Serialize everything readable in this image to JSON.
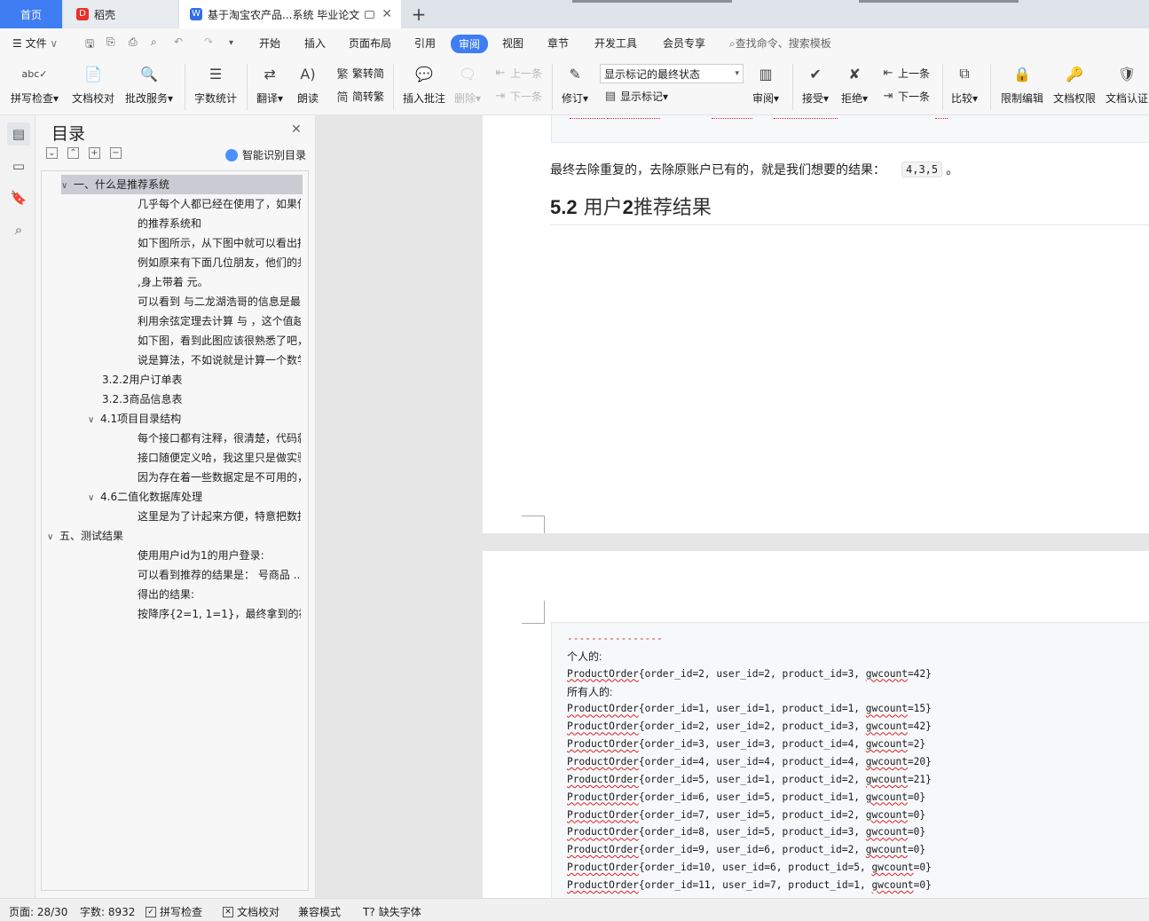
{
  "tabs": {
    "home": "首页",
    "daoke": "稻壳",
    "doc": "基于淘宝农产品...系统 毕业论文",
    "add": "+"
  },
  "menu": {
    "file": "文件",
    "items": [
      "开始",
      "插入",
      "页面布局",
      "引用",
      "审阅",
      "视图",
      "章节",
      "开发工具",
      "会员专享"
    ],
    "search": "查找命令、搜索模板"
  },
  "ribbon": {
    "spell": "拼写检查",
    "proof": "文档校对",
    "revise_service": "批改服务",
    "word_count": "字数统计",
    "translate": "翻译",
    "read_aloud": "朗读",
    "trad_to_simp": "繁转简",
    "simp_to_trad": "简转繁",
    "insert_comment": "插入批注",
    "delete": "删除",
    "prev": "上一条",
    "next": "下一条",
    "track": "修订",
    "markup_state": "显示标记的最终状态",
    "show_markup": "显示标记",
    "review": "审阅",
    "accept": "接受",
    "reject": "拒绝",
    "prev2": "上一条",
    "next2": "下一条",
    "compare": "比较",
    "restrict": "限制编辑",
    "permission": "文档权限",
    "cert": "文档认证"
  },
  "toc": {
    "title": "目录",
    "smart": "智能识别目录",
    "items": [
      {
        "text": "一、什么是推荐系统",
        "level": 1,
        "caret": "v"
      },
      {
        "text": "几乎每个人都已经在使用了，如果你...",
        "level": 3
      },
      {
        "text": "的推荐系统和",
        "level": 3
      },
      {
        "text": "如下图所示，从下图中就可以看出推...",
        "level": 3
      },
      {
        "text": "例如原来有下面几位朋友，他们的共...",
        "level": 3
      },
      {
        "text": ",身上带着 元。",
        "level": 3
      },
      {
        "text": "可以看到 与二龙湖浩哥的信息是最...",
        "level": 3
      },
      {
        "text": "利用余弦定理去计算 与 ，这个值越...",
        "level": 3
      },
      {
        "text": "如下图，看到此图应该很熟悉了吧，...",
        "level": 3
      },
      {
        "text": "说是算法，不如说就是计算一个数学...",
        "level": 3
      },
      {
        "text": "3.2.2用户订单表",
        "level": 2
      },
      {
        "text": "3.2.3商品信息表",
        "level": 2
      },
      {
        "text": "4.1项目目录结构",
        "level": 2,
        "caret": "v"
      },
      {
        "text": "每个接口都有注释，很清楚，代码就...",
        "level": 3
      },
      {
        "text": "接口随便定义哈，我这里只是做实验...",
        "level": 3
      },
      {
        "text": "因为存在着一些数据定是不可用的，...",
        "level": 3
      },
      {
        "text": "4.6二值化数据库处理",
        "level": 2,
        "caret": "v"
      },
      {
        "text": "这里是为了计起来方便，特意把数据...",
        "level": 3
      },
      {
        "text": "五、测试结果",
        "level": 1,
        "caret": "v"
      },
      {
        "text": "使用用户id为1的用户登录:",
        "level": 3
      },
      {
        "text": "可以看到推荐的结果是： 号商品 ...",
        "level": 3
      },
      {
        "text": "得出的结果:",
        "level": 3
      },
      {
        "text": "按降序{2=1, 1=1}，最终拿到的被推...",
        "level": 3
      }
    ]
  },
  "doc": {
    "final_text": "最终去除重复的，去除原账户已有的，就是我们想要的结果：",
    "final_code": "4,3,5",
    "final_period": "。",
    "heading_num": "5.2",
    "heading_pre": "用户",
    "heading_bold": "2",
    "heading_post": "推荐结果",
    "code_lines": [
      "----------------",
      "个人的:",
      "ProductOrder{order_id=2, user_id=2, product_id=3, gwcount=42}",
      "所有人的:",
      "ProductOrder{order_id=1, user_id=1, product_id=1, gwcount=15}",
      "ProductOrder{order_id=2, user_id=2, product_id=3, gwcount=42}",
      "ProductOrder{order_id=3, user_id=3, product_id=4, gwcount=2}",
      "ProductOrder{order_id=4, user_id=4, product_id=4, gwcount=20}",
      "ProductOrder{order_id=5, user_id=1, product_id=2, gwcount=21}",
      "ProductOrder{order_id=6, user_id=5, product_id=1, gwcount=0}",
      "ProductOrder{order_id=7, user_id=5, product_id=2, gwcount=0}",
      "ProductOrder{order_id=8, user_id=5, product_id=3, gwcount=0}",
      "ProductOrder{order_id=9, user_id=6, product_id=2, gwcount=0}",
      "ProductOrder{order_id=10, user_id=6, product_id=5, gwcount=0}",
      "ProductOrder{order_id=11, user_id=7, product_id=1, gwcount=0}"
    ]
  },
  "status": {
    "page": "页面: 28/30",
    "words": "字数: 8932",
    "spell": "拼写检查",
    "proof": "文档校对",
    "compat": "兼容模式",
    "missing_font": "缺失字体"
  },
  "colors": {
    "accent": "#3f7df3",
    "error": "#d22222"
  }
}
